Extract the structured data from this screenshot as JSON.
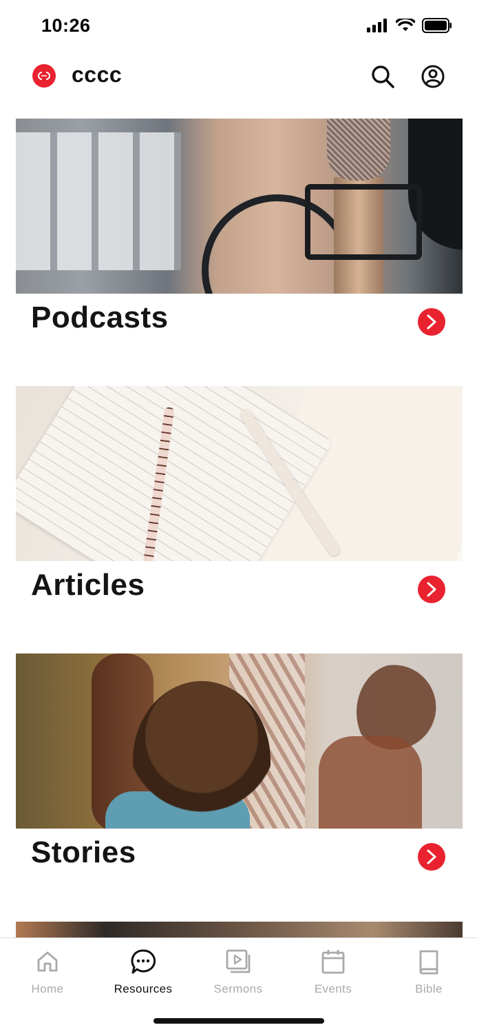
{
  "status_bar": {
    "time": "10:26"
  },
  "header": {
    "title": "cccc"
  },
  "cards": [
    {
      "title": "Podcasts"
    },
    {
      "title": "Articles"
    },
    {
      "title": "Stories"
    }
  ],
  "tabs": [
    {
      "label": "Home",
      "icon": "home-icon",
      "active": false
    },
    {
      "label": "Resources",
      "icon": "chat-bubble-icon",
      "active": true
    },
    {
      "label": "Sermons",
      "icon": "video-play-icon",
      "active": false
    },
    {
      "label": "Events",
      "icon": "calendar-icon",
      "active": false
    },
    {
      "label": "Bible",
      "icon": "book-icon",
      "active": false
    }
  ],
  "colors": {
    "accent": "#e8232f",
    "tab_inactive": "#a9a9a9",
    "tab_active": "#111111"
  }
}
